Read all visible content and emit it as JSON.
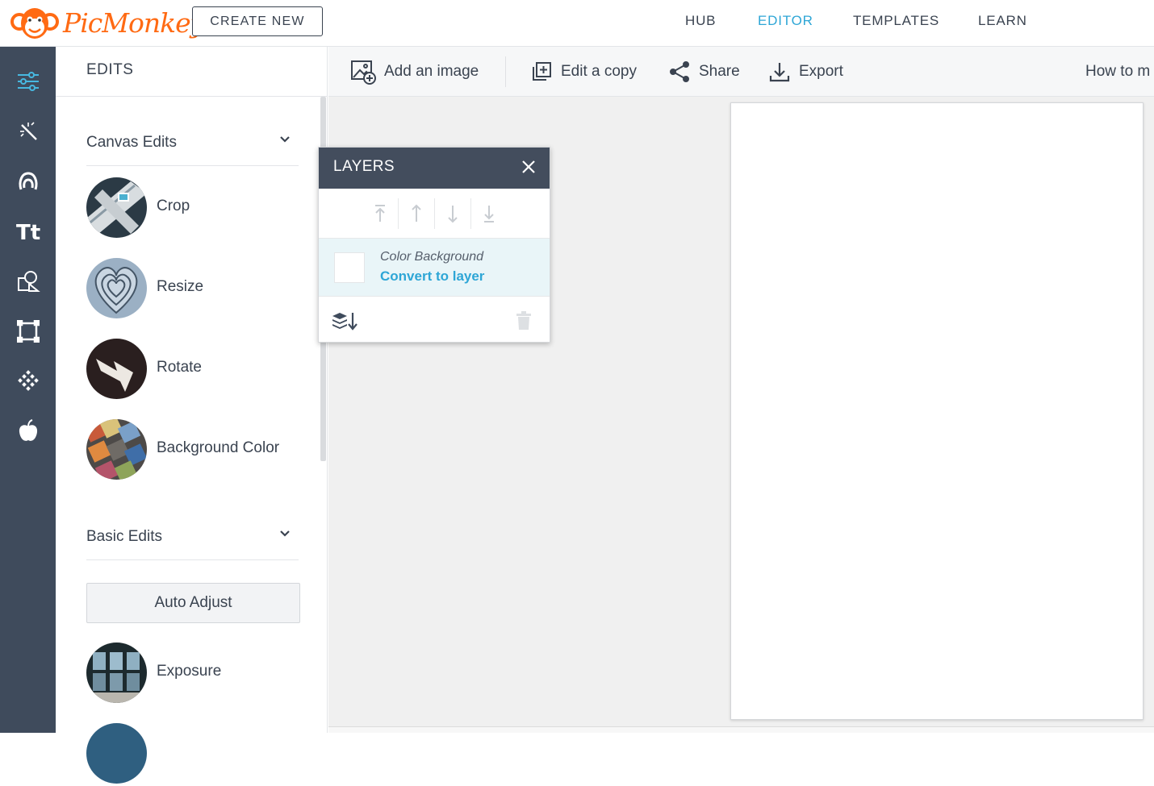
{
  "app": {
    "logo_text": "PicMonkey",
    "brand_color": "#ff6a13",
    "accent_color": "#2ea6d6"
  },
  "header": {
    "create_new": "CREATE NEW",
    "nav": [
      {
        "label": "HUB",
        "active": false
      },
      {
        "label": "EDITOR",
        "active": true
      },
      {
        "label": "TEMPLATES",
        "active": false
      },
      {
        "label": "LEARN",
        "active": false
      }
    ]
  },
  "rail": {
    "icons": [
      "sliders-icon",
      "magic-wand-icon",
      "face-icon",
      "text-icon",
      "shapes-icon",
      "frame-icon",
      "texture-icon",
      "apple-icon"
    ],
    "active": "sliders-icon"
  },
  "edits_panel": {
    "title": "EDITS",
    "sections": [
      {
        "title": "Canvas Edits",
        "tools": [
          "Crop",
          "Resize",
          "Rotate",
          "Background Color"
        ]
      },
      {
        "title": "Basic Edits",
        "auto_adjust": "Auto Adjust",
        "tools": [
          "Exposure"
        ]
      }
    ]
  },
  "toolbar": {
    "add_image": "Add an image",
    "edit_copy": "Edit a copy",
    "share": "Share",
    "export": "Export",
    "how_to": "How to m"
  },
  "layers": {
    "title": "LAYERS",
    "layer_name": "Color Background",
    "convert_link": "Convert to layer",
    "swatch_color": "#ffffff"
  }
}
